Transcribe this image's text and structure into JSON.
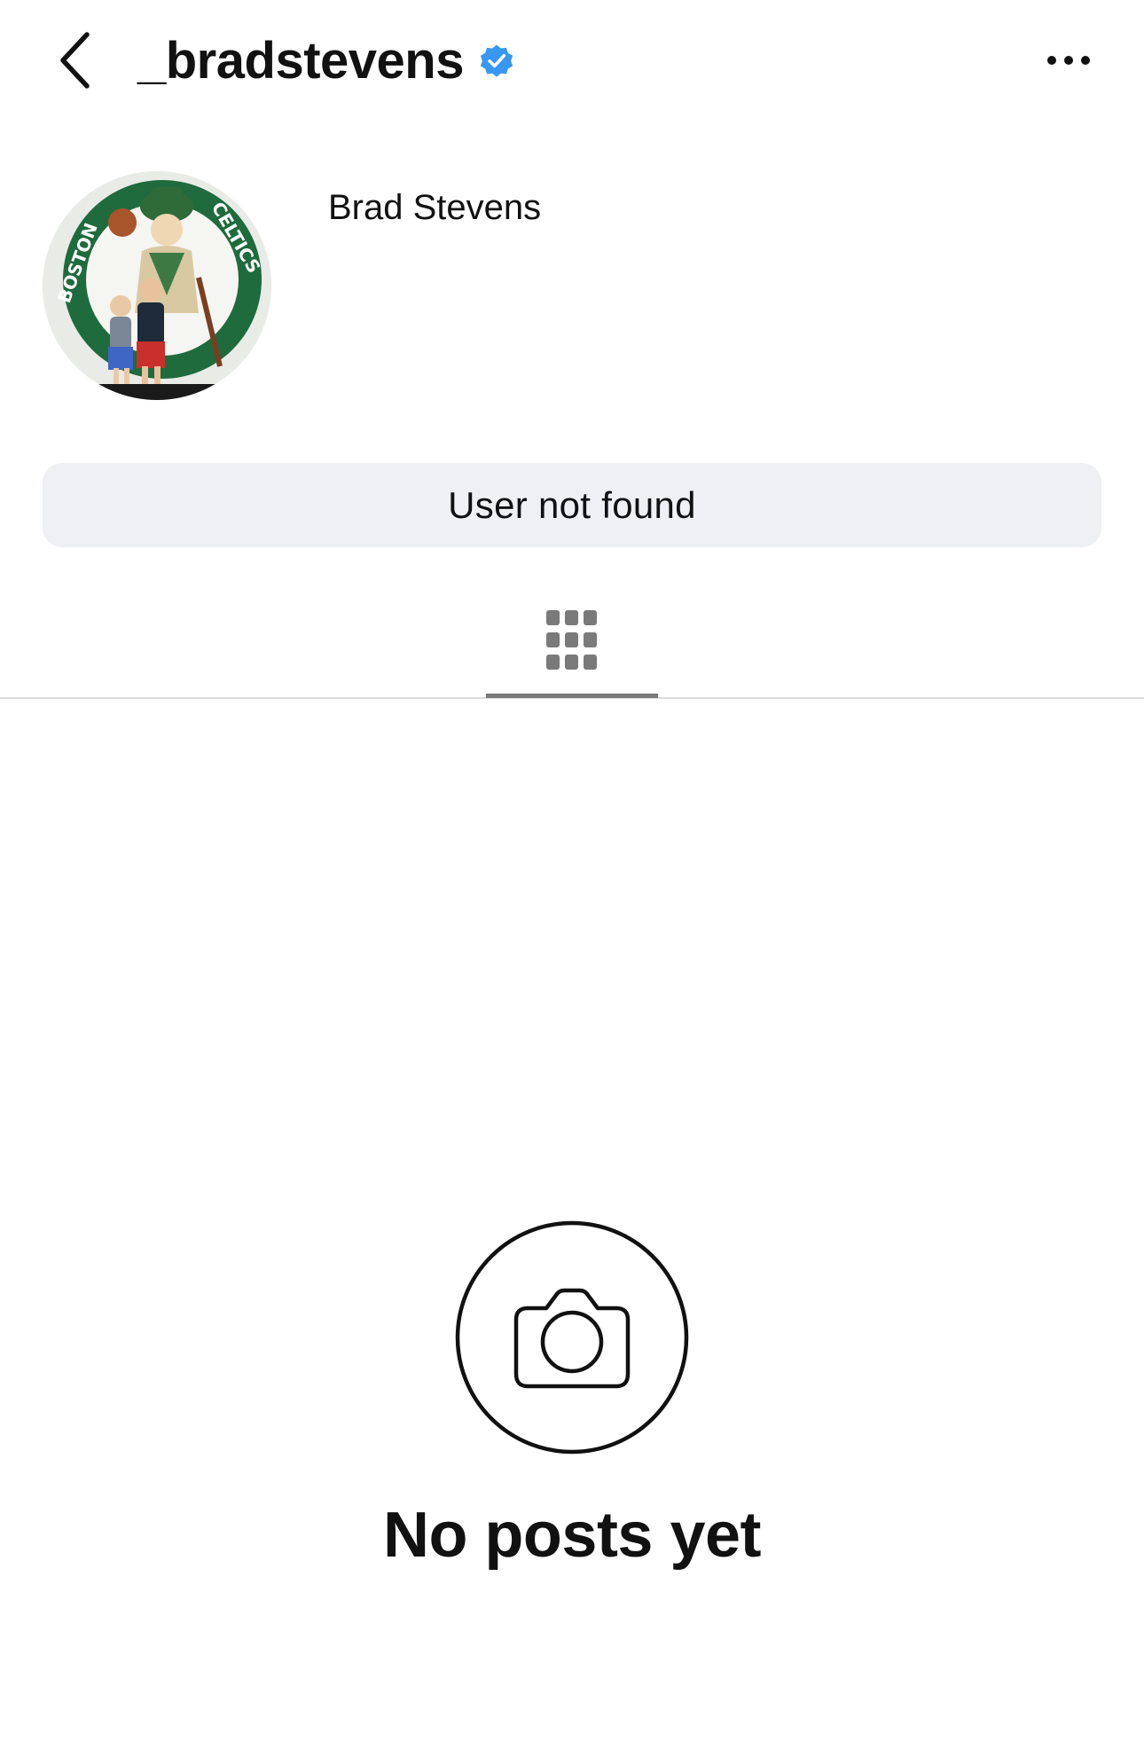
{
  "header": {
    "username": "_bradstevens",
    "back_icon": "chevron-left-icon",
    "verified_icon": "verified-badge-icon",
    "more_icon": "more-horizontal-icon",
    "verified_color": "#3897f0"
  },
  "profile": {
    "display_name": "Brad Stevens",
    "avatar": "Boston Celtics logo mural with two children"
  },
  "status": {
    "label": "User not found"
  },
  "tabs": {
    "active": "grid-icon"
  },
  "empty_state": {
    "icon": "camera-icon",
    "message": "No posts yet"
  }
}
